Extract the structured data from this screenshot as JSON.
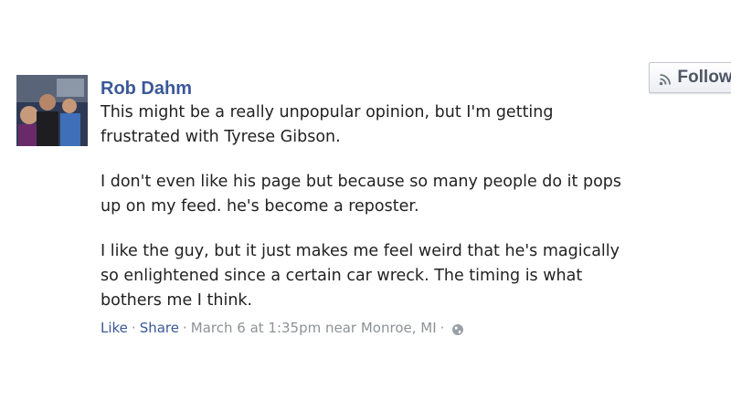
{
  "post": {
    "author": "Rob Dahm",
    "follow_label": "Follow",
    "paragraphs": [
      "This might be a really unpopular opinion, but I'm getting\nfrustrated with Tyrese Gibson.",
      "I don't even like his page but because so many people do it pops\nup on my feed. he's become a reposter.",
      "I like the guy, but it just makes me feel weird that he's magically\nso enlightened since a certain car wreck. The timing is what\nbothers me I think."
    ],
    "footer": {
      "like_label": "Like",
      "share_label": "Share",
      "separator": "·",
      "timestamp": "March 6 at 1:35pm near Monroe, MI"
    }
  },
  "icons": {
    "follow": "rss-icon",
    "privacy": "globe-icon"
  },
  "colors": {
    "link": "#3b5998",
    "text": "#222222",
    "meta": "#8e9296",
    "button_text": "#4e5665"
  }
}
